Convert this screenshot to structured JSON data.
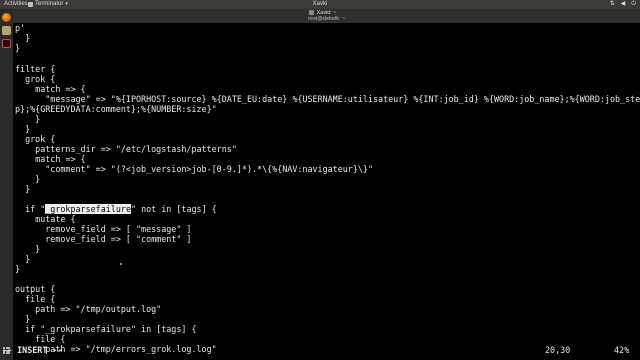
{
  "top_panel": {
    "activities": "Activities",
    "app_name": "Terminator",
    "clock": "Xavki",
    "status_icons": [
      "network-icon",
      "volume-icon",
      "power-icon"
    ]
  },
  "window": {
    "title": "Xavki: ~",
    "subtitle": "root@debelk: ~"
  },
  "editor": {
    "lines": [
      "p'",
      "  }",
      "}",
      "",
      "filter {",
      "  grok {",
      "    match => {",
      "      \"message\" => \"%{IPORHOST:source} %{DATE_EU:date} %{USERNAME:utilisateur} %{INT:job_id} %{WORD:job_name};%{WORD:job_ste",
      "p};%{GREEDYDATA:comment};%{NUMBER:size}\"",
      "    }",
      "  }",
      "  grok {",
      "    patterns_dir => \"/etc/logstash/patterns\"",
      "    match => {",
      "      \"comment\" => \"(?<job_version>job-[0-9.]*).*\\{%{NAV:navigateur}\\}\"",
      "    }",
      "  }",
      "",
      "  if \"_grokparsefailure\" not in [tags] {",
      "    mutate {",
      "      remove_field => [ \"message\" ]",
      "      remove_field => [ \"comment\" ]",
      "    }",
      "  }",
      "}",
      "",
      "output {",
      "  file {",
      "    path => \"/tmp/output.log\"",
      "  }",
      "  if \"_grokparsefailure\" in [tags] {",
      "    file {",
      "      path => \"/tmp/errors_grok.log.log\""
    ],
    "highlight": {
      "line_index": 18,
      "before": "  if \"",
      "selected": "_grokparsefailure",
      "after": "\" not in [tags] {"
    }
  },
  "status": {
    "mode": "-- INSERT --",
    "position": "20,30",
    "percent": "42%"
  }
}
